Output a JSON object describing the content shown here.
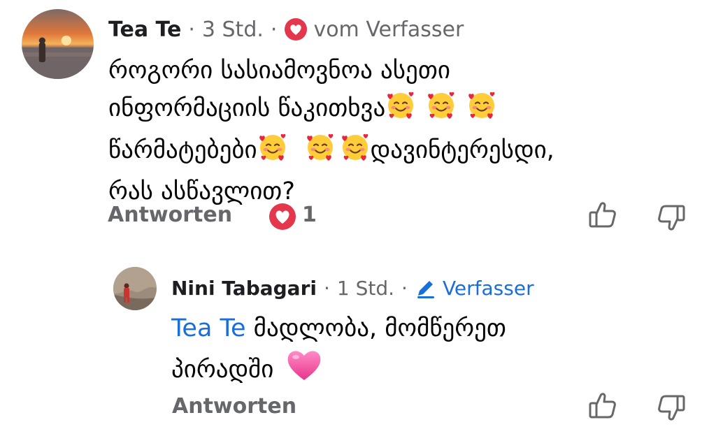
{
  "comment": {
    "author": "Tea Te",
    "time": "3 Std.",
    "separator": "·",
    "author_badge": "vom Verfasser",
    "badge_icon": "heart-badge-icon",
    "lines": [
      "როგორი სასიამოვნოა ასეთი",
      "ინფორმაციის წაკითხვა",
      "წარმატებები",
      "დავინტერესდი,",
      "რას ასწავლით?"
    ],
    "emoji_name": "smiling-face-with-hearts",
    "reply_label": "Antworten",
    "reaction_count": "1",
    "reaction_icon": "love-reaction-icon"
  },
  "reply": {
    "author": "Nini Tabagari",
    "time": "1 Std.",
    "separator": "·",
    "author_badge": "Verfasser",
    "badge_icon": "pencil-icon",
    "mention": "Tea Te",
    "lines": [
      "მადლობა, მომწერეთ",
      "პირადში"
    ],
    "emoji_name": "pink-heart",
    "reply_label": "Antworten"
  },
  "colors": {
    "text": "#1c1e21",
    "meta": "#65676b",
    "link_blue": "#1a6ed8",
    "heart_red": "#e4364d",
    "heart_pink": "#f25ea5"
  }
}
